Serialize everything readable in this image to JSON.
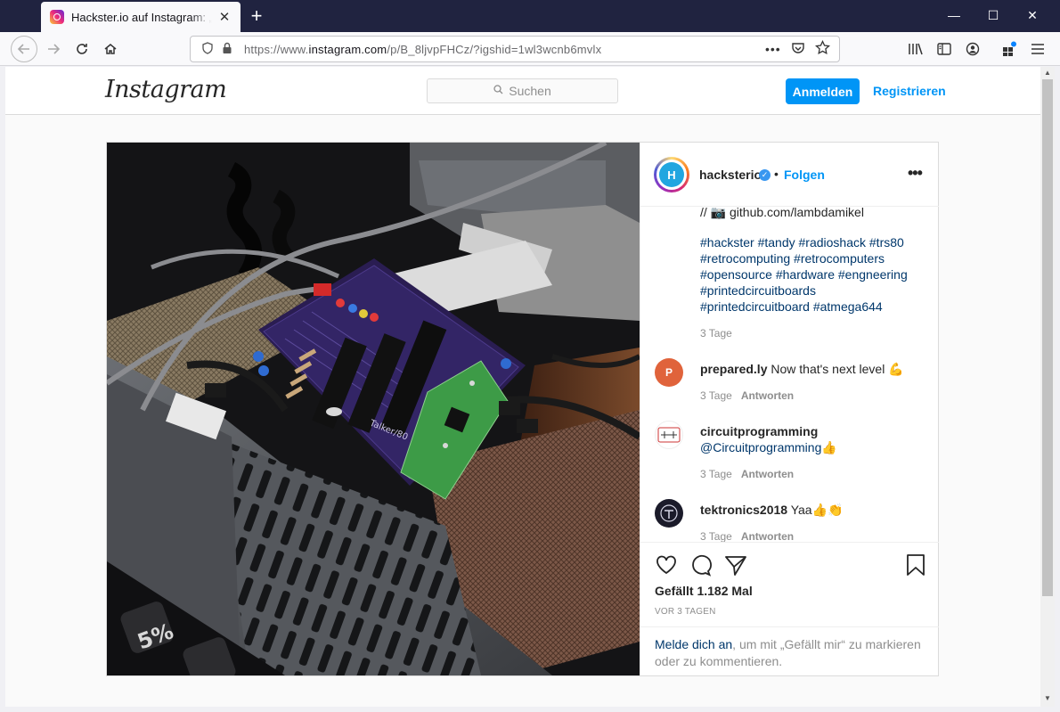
{
  "browser": {
    "tab_title": "Hackster.io auf Instagram: „Mic",
    "tab_close": "✕",
    "new_tab": "+",
    "url_prefix": "https://www.",
    "url_domain": "instagram.com",
    "url_path": "/p/B_8ljvpFHCz/?igshid=1wl3wcnb6mvlx",
    "window_minimize": "—",
    "window_maximize": "☐",
    "window_close": "✕"
  },
  "ig_header": {
    "logo": "Instagram",
    "search_placeholder": "Suchen",
    "login_label": "Anmelden",
    "register_label": "Registrieren"
  },
  "post": {
    "username": "hacksterio",
    "dot": "•",
    "follow_label": "Folgen",
    "more": "•••",
    "caption_top": "// 📷 github.com/lambdamikel",
    "hashtags": [
      "#hackster #tandy #radioshack #trs80",
      "#retrocomputing #retrocomputers",
      "#opensource #hardware #engneering",
      "#printedcircuitboards",
      "#printedcircuitboard #atmega644"
    ],
    "caption_age": "3 Tage",
    "comments": [
      {
        "user": "prepared.ly",
        "text": " Now that's next level 💪",
        "age": "3 Tage",
        "reply": "Antworten",
        "avatar_letter": "P",
        "avatar_color": "#e0633b"
      },
      {
        "user": "circuitprogramming",
        "text": "@Circuitprogramming👍",
        "age": "3 Tage",
        "reply": "Antworten",
        "avatar_letter": "",
        "avatar_color": "#ffffff"
      },
      {
        "user": "tektronics2018",
        "text": " Yaa👍👏",
        "age": "3 Tage",
        "reply": "Antworten",
        "avatar_letter": "",
        "avatar_color": "#1b1b2a"
      }
    ],
    "likes": "Gefällt 1.182 Mal",
    "date": "VOR 3 TAGEN",
    "login_link": "Melde dich an",
    "login_rest_1": ", um mit „Gefällt mir“ zu markieren",
    "login_rest_2": "oder zu kommentieren."
  },
  "photo": {
    "board_label": "Talker/80",
    "key_label": "5%"
  }
}
